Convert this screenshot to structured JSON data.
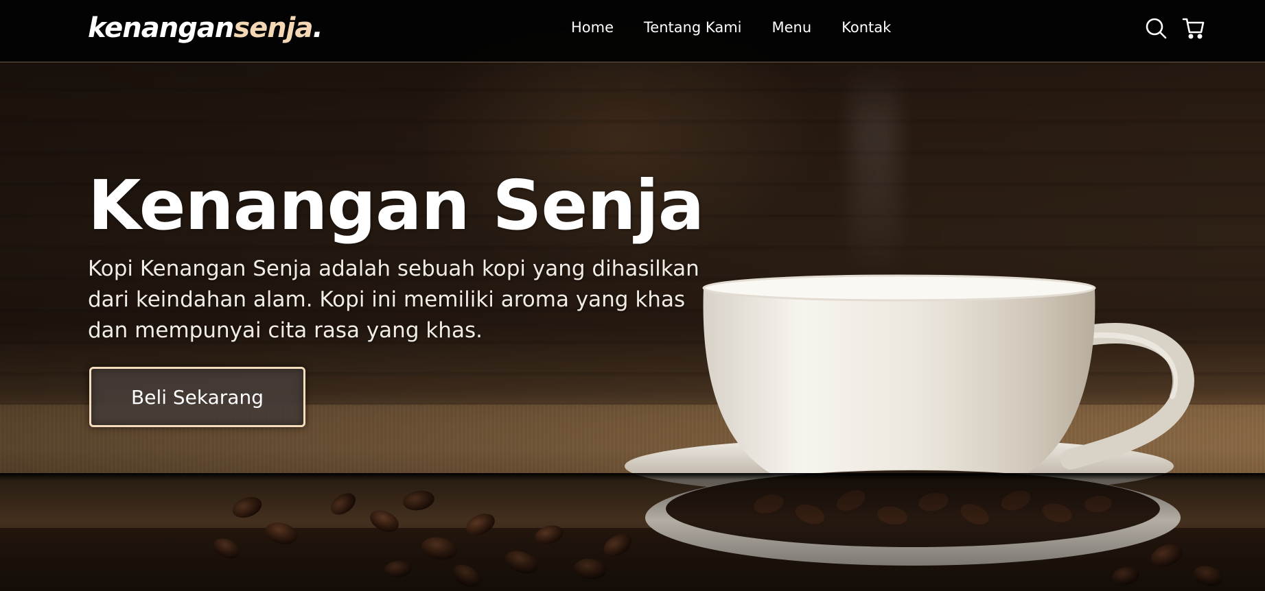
{
  "navbar": {
    "logo_main": "kenangan",
    "logo_accent": "senja",
    "logo_dot": ".",
    "links": [
      "Home",
      "Tentang Kami",
      "Menu",
      "Kontak"
    ],
    "icons": [
      "search-icon",
      "shopping-cart-icon"
    ],
    "logo_accent_color": "#f4d7b4"
  },
  "hero": {
    "title": "Kenangan Senja",
    "description": "Kopi Kenangan Senja adalah sebuah kopi yang dihasilkan dari keindahan alam. Kopi ini memiliki aroma yang khas dan mempunyai cita rasa yang khas.",
    "cta_label": "Beli Sekarang",
    "cta_border_color": "#f4dcbc"
  }
}
